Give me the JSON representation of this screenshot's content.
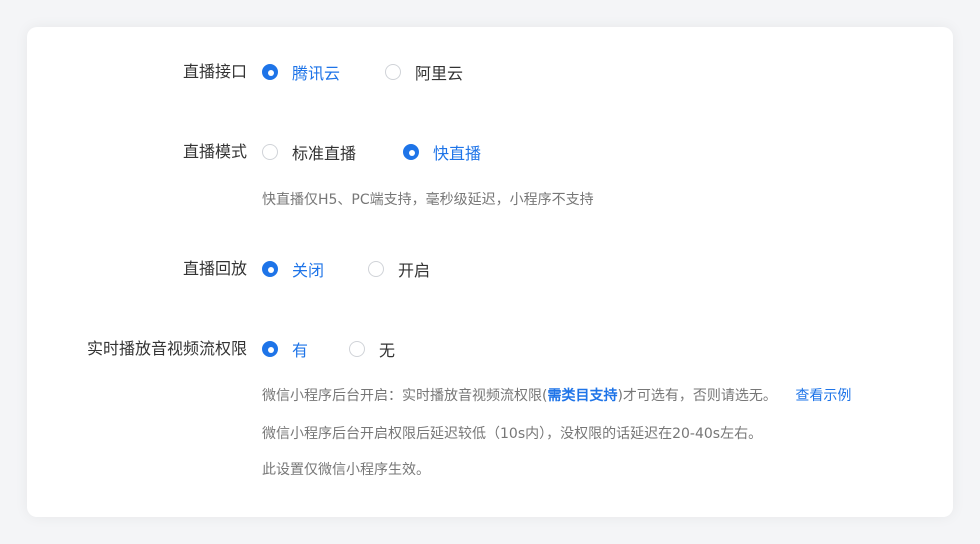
{
  "live_api": {
    "label": "直播接口",
    "options": [
      {
        "label": "腾讯云",
        "selected": true
      },
      {
        "label": "阿里云",
        "selected": false
      }
    ]
  },
  "live_mode": {
    "label": "直播模式",
    "options": [
      {
        "label": "标准直播",
        "selected": false
      },
      {
        "label": "快直播",
        "selected": true
      }
    ],
    "hint": "快直播仅H5、PC端支持，毫秒级延迟，小程序不支持"
  },
  "live_replay": {
    "label": "直播回放",
    "options": [
      {
        "label": "关闭",
        "selected": true
      },
      {
        "label": "开启",
        "selected": false
      }
    ]
  },
  "realtime_permission": {
    "label": "实时播放音视频流权限",
    "options": [
      {
        "label": "有",
        "selected": true
      },
      {
        "label": "无",
        "selected": false
      }
    ],
    "hint1_prefix": "微信小程序后台开启：实时播放音视频流权限(",
    "hint1_link": "需类目支持",
    "hint1_suffix": ")才可选有，否则请选无。",
    "view_example": "查看示例",
    "hint2": "微信小程序后台开启权限后延迟较低（10s内），没权限的话延迟在20-40s左右。",
    "hint3": "此设置仅微信小程序生效。"
  },
  "colors": {
    "accent": "#1e74e8",
    "text": "#333333",
    "hint": "#777777",
    "radio_border": "#d0d3d8"
  }
}
